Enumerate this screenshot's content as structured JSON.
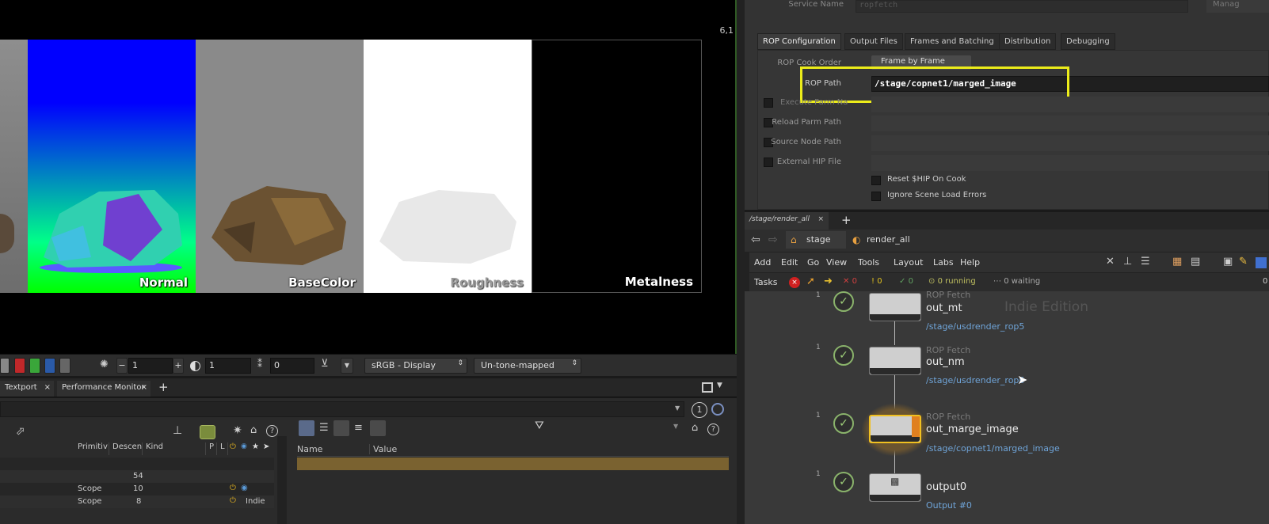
{
  "viewport": {
    "corner_text": "6,1",
    "swatches": [
      "Normal",
      "BaseColor",
      "Roughness",
      "Metalness"
    ],
    "toolbar": {
      "field1": "1",
      "field2": "1",
      "field3": "0",
      "colorspace": "sRGB - Display",
      "tonemap": "Un-tone-mapped"
    }
  },
  "bottom_left": {
    "tabs": [
      "Textport",
      "Performance Monitor"
    ],
    "add_tab": "+",
    "badge": "1",
    "scene_tree": {
      "headers": [
        "Primitiv",
        "Descen",
        "Kind",
        "P",
        "L"
      ],
      "rows": [
        {
          "kind": "",
          "count": "54",
          "extra": ""
        },
        {
          "kind": "Scope",
          "count": "10",
          "extra": ""
        },
        {
          "kind": "Scope",
          "count": "8",
          "extra": "Indie"
        }
      ]
    },
    "properties": {
      "headers": [
        "Name",
        "Value"
      ]
    }
  },
  "params": {
    "service_name_label": "Service Name",
    "service_name_value": "ropfetch",
    "manage": "Manag",
    "tabs": [
      "ROP Configuration",
      "Output Files",
      "Frames and Batching",
      "Distribution",
      "Debugging"
    ],
    "rop_cook_order_label": "ROP Cook Order",
    "rop_cook_order_value": "Frame by Frame",
    "rop_path_label": "ROP Path",
    "rop_path_value": "/stage/copnet1/marged_image",
    "exec_label": "Execute Parm Na",
    "reload_label": "Reload Parm Path",
    "source_label": "Source Node Path",
    "external_label": "External HIP File",
    "reset_label": "Reset $HIP On Cook",
    "ignore_label": "Ignore Scene Load Errors"
  },
  "network": {
    "tab_label": "/stage/render_all",
    "breadcrumb": [
      "stage",
      "render_all"
    ],
    "menu": [
      "Add",
      "Edit",
      "Go",
      "View",
      "Tools",
      "Layout",
      "Labs",
      "Help"
    ],
    "tasks": {
      "label": "Tasks",
      "failed": "0",
      "warnings": "0",
      "done": "0",
      "running": "0 running",
      "waiting": "0 waiting",
      "right_count": "0"
    },
    "watermark": "Indie Edition",
    "nodes": [
      {
        "type": "ROP Fetch",
        "name": "out_mt",
        "path": "/stage/usdrender_rop5",
        "count": "1"
      },
      {
        "type": "ROP Fetch",
        "name": "out_nm",
        "path": "/stage/usdrender_rop6",
        "count": "1"
      },
      {
        "type": "ROP Fetch",
        "name": "out_marge_image",
        "path": "/stage/copnet1/marged_image",
        "count": "1"
      },
      {
        "type": "",
        "name": "output0",
        "path": "Output #0",
        "count": "1"
      }
    ]
  }
}
